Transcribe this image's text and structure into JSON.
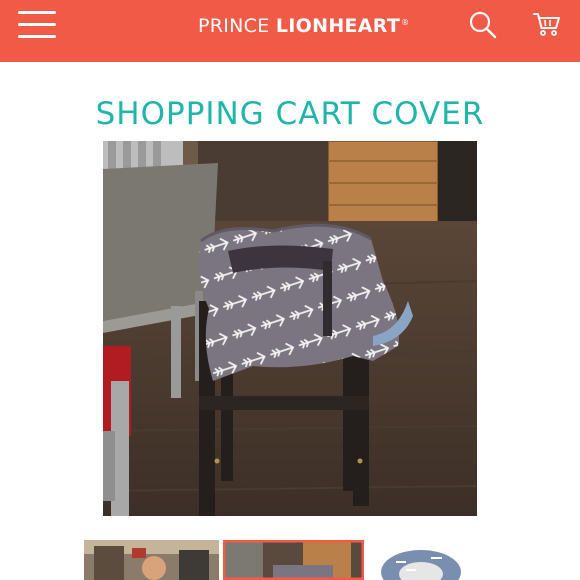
{
  "header": {
    "brand_light": "PRINCE ",
    "brand_bold": "LIONHEART",
    "brand_mark": "®",
    "bg_color": "#f25a48",
    "icons": [
      "menu-icon",
      "search-icon",
      "cart-icon"
    ]
  },
  "product": {
    "title": "SHOPPING CART COVER",
    "title_color": "#20b5aa"
  },
  "gallery": {
    "selected_index": 1,
    "thumbnail_count": 3
  }
}
